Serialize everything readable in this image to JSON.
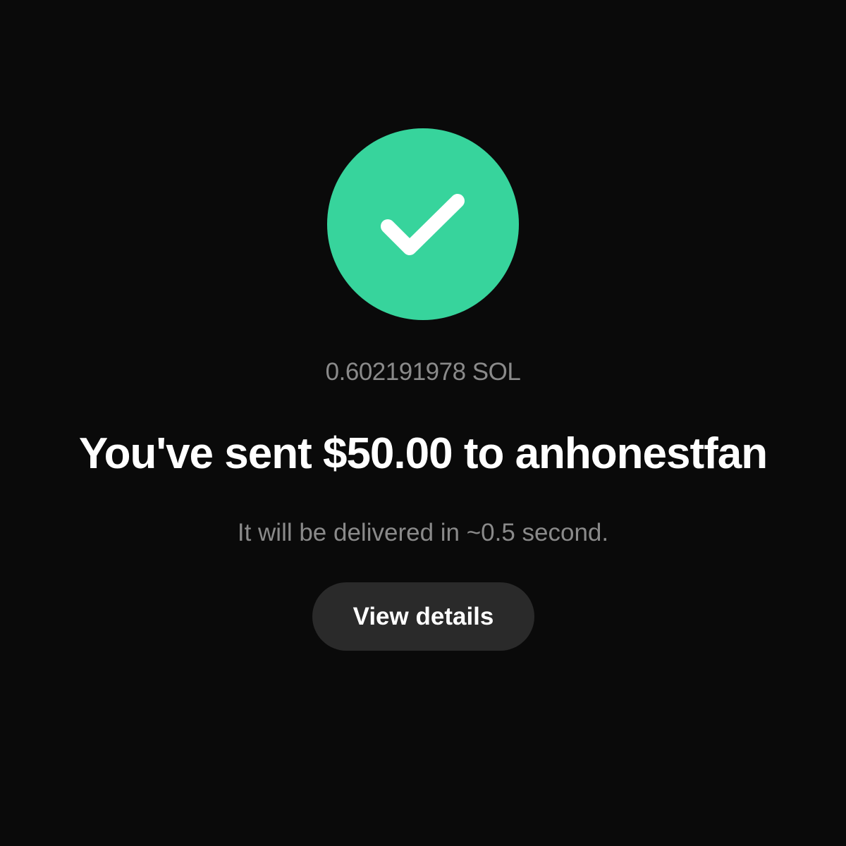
{
  "status_icon": {
    "name": "checkmark-circle-icon",
    "circle_color": "#37d49c",
    "check_color": "#ffffff"
  },
  "transaction": {
    "crypto_amount": "0.602191978 SOL",
    "headline": "You've sent $50.00 to anhonestfan",
    "delivery_note": "It will be delivered in ~0.5 second."
  },
  "actions": {
    "view_details_label": "View details"
  },
  "colors": {
    "background": "#0a0a0a",
    "muted_text": "#8a8a8a",
    "button_bg": "#2a2a2a"
  }
}
